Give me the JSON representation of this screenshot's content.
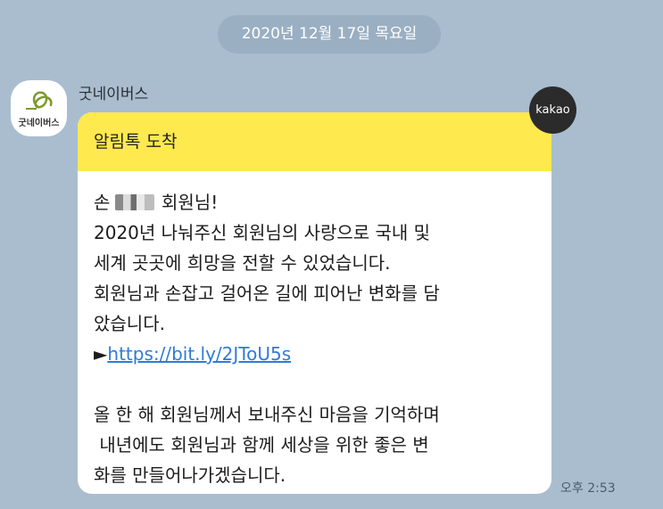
{
  "date_label": "2020년 12월 17일 목요일",
  "sender": {
    "name": "굿네이버스",
    "avatar_text": "굿네이버스",
    "badge": "kakao"
  },
  "message": {
    "header": "알림톡 도착",
    "greeting_prefix": "손",
    "greeting_suffix": "회원님!",
    "lines": [
      "2020년 나눠주신 회원님의 사랑으로 국내 및",
      "세계 곳곳에 희망을 전할 수 있었습니다.",
      "회원님과 손잡고 걸어온 길에 피어난 변화를 담",
      "았습니다."
    ],
    "arrow": "►",
    "link": "https://bit.ly/2JToU5s",
    "closing_lines": [
      "올 한 해 회원님께서 보내주신 마음을 기억하며",
      " 내년에도 회원님과 함께 세상을 위한 좋은 변",
      "화를 만들어나가겠습니다."
    ]
  },
  "time": "오후 2:53",
  "colors": {
    "background": "#a9bdcf",
    "header_yellow": "#fee94f",
    "link_blue": "#2f7bd9",
    "logo_green": "#7d9a2c"
  }
}
